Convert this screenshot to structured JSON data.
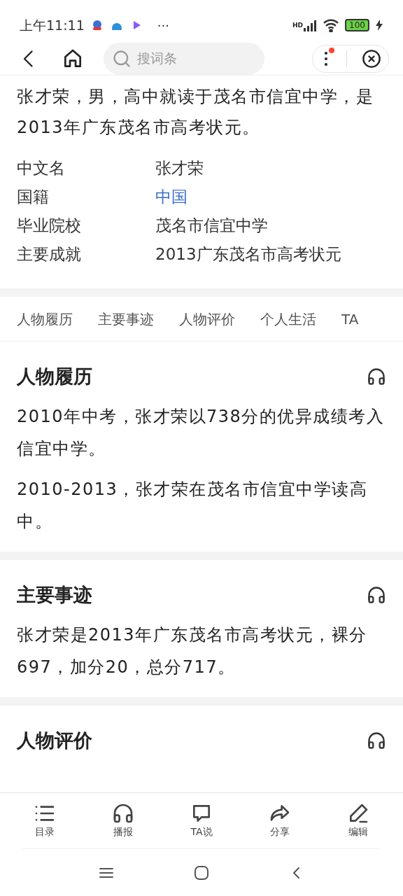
{
  "status_bar": {
    "time": "上午11:11",
    "more": "···",
    "network": "HD",
    "battery": "100"
  },
  "nav": {
    "search_placeholder": "搜词条",
    "has_notification": true
  },
  "intro": "张才荣，男，高中就读于茂名市信宜中学，是2013年广东茂名市高考状元。",
  "info": [
    {
      "label": "中文名",
      "value": "张才荣",
      "link": false
    },
    {
      "label": "国籍",
      "value": "中国",
      "link": true
    },
    {
      "label": "毕业院校",
      "value": "茂名市信宜中学",
      "link": false
    },
    {
      "label": "主要成就",
      "value": "2013广东茂名市高考状元",
      "link": false
    }
  ],
  "tabs": [
    "人物履历",
    "主要事迹",
    "人物评价",
    "个人生活",
    "TA"
  ],
  "sections": [
    {
      "title": "人物履历",
      "paragraphs": [
        "2010年中考，张才荣以738分的优异成绩考入信宜中学。",
        "2010-2013，张才荣在茂名市信宜中学读高中。"
      ]
    },
    {
      "title": "主要事迹",
      "paragraphs": [
        "张才荣是2013年广东茂名市高考状元，裸分697，加分20，总分717。"
      ]
    },
    {
      "title": "人物评价"
    }
  ],
  "toolbar": [
    {
      "kind": "list",
      "label": "目录"
    },
    {
      "kind": "headphones",
      "label": "播报"
    },
    {
      "kind": "comment",
      "label": "TA说"
    },
    {
      "kind": "share",
      "label": "分享"
    },
    {
      "kind": "edit",
      "label": "编辑"
    }
  ]
}
